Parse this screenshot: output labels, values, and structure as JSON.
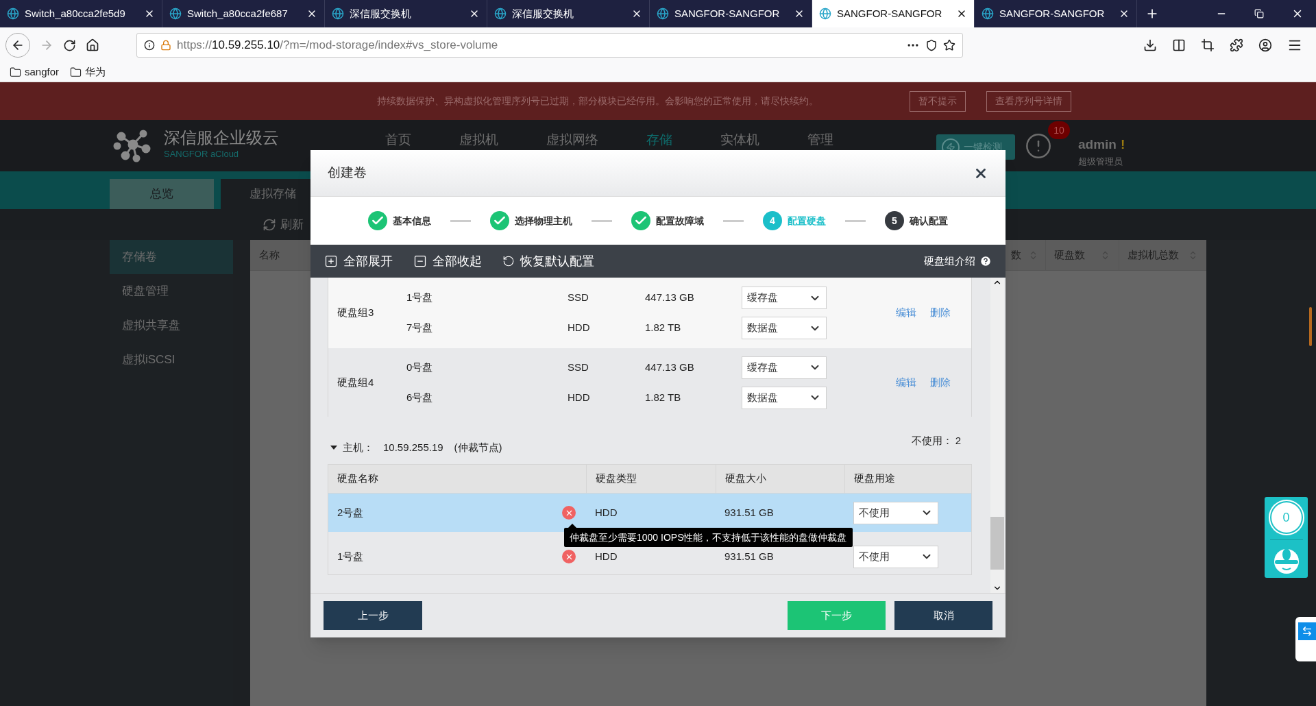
{
  "browser": {
    "tabs": [
      {
        "title": "Switch_a80cca2fe5d9",
        "selected": false
      },
      {
        "title": "Switch_a80cca2fe687",
        "selected": false
      },
      {
        "title": "深信服交换机",
        "selected": false
      },
      {
        "title": "深信服交换机",
        "selected": false
      },
      {
        "title": "SANGFOR-SANGFOR",
        "selected": false
      },
      {
        "title": "SANGFOR-SANGFOR",
        "selected": true
      },
      {
        "title": "SANGFOR-SANGFOR",
        "selected": false
      }
    ],
    "url": {
      "scheme": "https://",
      "host": "10.59.255.10",
      "path": "/?m=/mod-storage/index#vs_store-volume"
    },
    "bookmarks": [
      "sangfor",
      "华为"
    ]
  },
  "banner": {
    "message": "持续数据保护、异构虚拟化管理序列号已过期，部分模块已经停用。会影响您的正常使用，请尽快续约。",
    "buttons": [
      "暂不提示",
      "查看序列号详情"
    ]
  },
  "header": {
    "brand": "深信服企业级云",
    "brand_sub": "SANGFOR aCloud",
    "nav": [
      {
        "label": "首页",
        "selected": false
      },
      {
        "label": "虚拟机",
        "selected": false
      },
      {
        "label": "虚拟网络",
        "selected": false
      },
      {
        "label": "存储",
        "selected": true
      },
      {
        "label": "实体机",
        "selected": false
      },
      {
        "label": "管理",
        "selected": false
      }
    ],
    "check_button": "一键检测",
    "alert_count": "10",
    "user": "admin",
    "user_flag": "!",
    "role": "超级管理员"
  },
  "tabs": [
    {
      "label": "总览",
      "selected": false
    },
    {
      "label": "虚拟存储",
      "selected": true
    }
  ],
  "toolbar": {
    "refresh": "刷新"
  },
  "sidebar": {
    "items": [
      {
        "label": "存储卷",
        "selected": true
      },
      {
        "label": "硬盘管理",
        "selected": false
      },
      {
        "label": "虚拟共享盘",
        "selected": false
      },
      {
        "label": "虚拟iSCSI",
        "selected": false
      }
    ]
  },
  "table": {
    "columns": [
      "名称",
      "数",
      "硬盘数",
      "虚拟机总数"
    ]
  },
  "dialog": {
    "title": "创建卷",
    "steps": [
      {
        "label": "基本信息",
        "kind": "done"
      },
      {
        "label": "选择物理主机",
        "kind": "done"
      },
      {
        "label": "配置故障域",
        "kind": "done"
      },
      {
        "number": "4",
        "label": "配置硬盘",
        "kind": "active"
      },
      {
        "number": "5",
        "label": "确认配置",
        "kind": "pending"
      }
    ],
    "actions": [
      {
        "kind": "expand",
        "label": "全部展开"
      },
      {
        "kind": "collapse",
        "label": "全部收起"
      },
      {
        "kind": "reset",
        "label": "恢复默认配置"
      }
    ],
    "help": "硬盘组介绍",
    "groups": [
      {
        "name": "硬盘组3",
        "disks": [
          {
            "name": "1号盘",
            "type": "SSD",
            "size": "447.13 GB",
            "role": "缓存盘"
          },
          {
            "name": "7号盘",
            "type": "HDD",
            "size": "1.82 TB",
            "role": "数据盘"
          }
        ],
        "links": [
          "编辑",
          "删除"
        ]
      },
      {
        "name": "硬盘组4",
        "disks": [
          {
            "name": "0号盘",
            "type": "SSD",
            "size": "447.13 GB",
            "role": "缓存盘"
          },
          {
            "name": "6号盘",
            "type": "HDD",
            "size": "1.82 TB",
            "role": "数据盘"
          }
        ],
        "links": [
          "编辑",
          "删除"
        ]
      }
    ],
    "host": {
      "expanded": true,
      "label": "主机：",
      "address": "10.59.255.19",
      "note": "(仲裁节点)",
      "unused_label": "不使用：",
      "unused_count": "2"
    },
    "disk_table": {
      "columns": [
        "硬盘名称",
        "硬盘类型",
        "硬盘大小",
        "硬盘用途"
      ],
      "rows": [
        {
          "name": "2号盘",
          "error": true,
          "type": "HDD",
          "size": "931.51 GB",
          "use": "不使用",
          "selected": true
        },
        {
          "name": "1号盘",
          "error": true,
          "type": "HDD",
          "size": "931.51 GB",
          "use": "不使用",
          "selected": false
        }
      ],
      "tooltip": "仲裁盘至少需要1000 IOPS性能，不支持低于该性能的盘做仲裁盘"
    },
    "buttons": {
      "back": "上一步",
      "next": "下一步",
      "cancel": "取消"
    }
  },
  "widget": {
    "count": "0"
  }
}
